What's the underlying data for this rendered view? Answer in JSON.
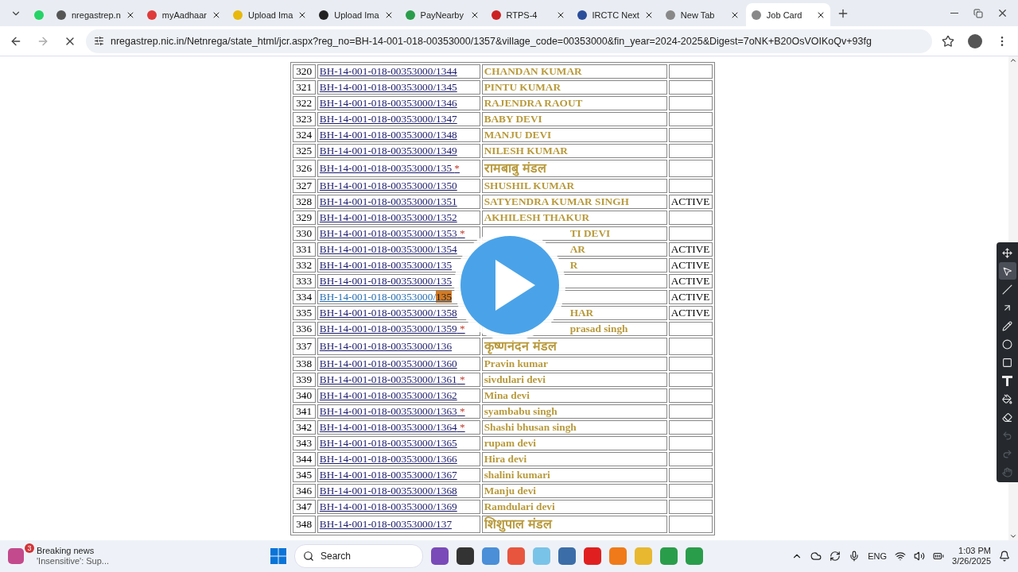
{
  "tabs": [
    {
      "kind": "pinned",
      "selected": false
    },
    {
      "title": "nregastrep.n",
      "selected": false
    },
    {
      "title": "myAadhaar",
      "selected": false
    },
    {
      "title": "Upload Ima",
      "selected": false
    },
    {
      "title": "Upload Ima",
      "selected": false
    },
    {
      "title": "PayNearby",
      "selected": false
    },
    {
      "title": "RTPS-4",
      "selected": false
    },
    {
      "title": "IRCTC Next",
      "selected": false
    },
    {
      "title": "New Tab",
      "selected": false
    },
    {
      "title": "Job Card",
      "selected": true
    }
  ],
  "address": "nregastrep.nic.in/Netnrega/state_html/jcr.aspx?reg_no=BH-14-001-018-00353000/1357&village_code=00353000&fin_year=2024-2025&Digest=7oNK+B20OsVOIKoQv+93fg",
  "rows": [
    {
      "no": "320",
      "reg": "BH-14-001-018-00353000/1344",
      "name": "CHANDAN KUMAR"
    },
    {
      "no": "321",
      "reg": "BH-14-001-018-00353000/1345",
      "name": "PINTU KUMAR"
    },
    {
      "no": "322",
      "reg": "BH-14-001-018-00353000/1346",
      "name": "RAJENDRA RAOUT"
    },
    {
      "no": "323",
      "reg": "BH-14-001-018-00353000/1347",
      "name": "BABY DEVI"
    },
    {
      "no": "324",
      "reg": "BH-14-001-018-00353000/1348",
      "name": "MANJU DEVI"
    },
    {
      "no": "325",
      "reg": "BH-14-001-018-00353000/1349",
      "name": "NILESH KUMAR"
    },
    {
      "no": "326",
      "reg": "BH-14-001-018-00353000/135",
      "star": "*",
      "name": "रामबाबु मंडल",
      "kind": "devanagari"
    },
    {
      "no": "327",
      "reg": "BH-14-001-018-00353000/1350",
      "name": "SHUSHIL KUMAR"
    },
    {
      "no": "328",
      "reg": "BH-14-001-018-00353000/1351",
      "name": "SATYENDRA KUMAR SINGH",
      "status": "ACTIVE"
    },
    {
      "no": "329",
      "reg": "BH-14-001-018-00353000/1352",
      "name": "AKHILESH THAKUR"
    },
    {
      "no": "330",
      "reg": "BH-14-001-018-00353000/1353",
      "star": "*",
      "name": "TI DEVI",
      "covered": true
    },
    {
      "no": "331",
      "reg": "BH-14-001-018-00353000/1354",
      "name": "AR",
      "covered": true,
      "status": "ACTIVE"
    },
    {
      "no": "332",
      "reg": "BH-14-001-018-00353000/135",
      "name": "R",
      "covered": true,
      "status": "ACTIVE"
    },
    {
      "no": "333",
      "reg": "BH-14-001-018-00353000/135",
      "status": "ACTIVE"
    },
    {
      "no": "334",
      "reg": "BH-14-001-018-00353000/",
      "highlight": "135",
      "hover": true,
      "status": "ACTIVE"
    },
    {
      "no": "335",
      "reg": "BH-14-001-018-00353000/1358",
      "name": "HAR",
      "covered": true,
      "status": "ACTIVE"
    },
    {
      "no": "336",
      "reg": "BH-14-001-018-00353000/1359",
      "star": "*",
      "name": "prasad singh",
      "covered": true
    },
    {
      "no": "337",
      "reg": "BH-14-001-018-00353000/136",
      "name": "कृष्णनंदन मंडल",
      "kind": "devanagari"
    },
    {
      "no": "338",
      "reg": "BH-14-001-018-00353000/1360",
      "name": "Pravin kumar"
    },
    {
      "no": "339",
      "reg": "BH-14-001-018-00353000/1361",
      "star": "*",
      "name": "sivdulari devi"
    },
    {
      "no": "340",
      "reg": "BH-14-001-018-00353000/1362",
      "name": "Mina devi"
    },
    {
      "no": "341",
      "reg": "BH-14-001-018-00353000/1363",
      "star": "*",
      "name": "syambabu singh"
    },
    {
      "no": "342",
      "reg": "BH-14-001-018-00353000/1364",
      "star": "*",
      "name": "Shashi bhusan singh"
    },
    {
      "no": "343",
      "reg": "BH-14-001-018-00353000/1365",
      "name": "rupam devi"
    },
    {
      "no": "344",
      "reg": "BH-14-001-018-00353000/1366",
      "name": "Hira devi"
    },
    {
      "no": "345",
      "reg": "BH-14-001-018-00353000/1367",
      "name": "shalini kumari"
    },
    {
      "no": "346",
      "reg": "BH-14-001-018-00353000/1368",
      "name": "Manju devi"
    },
    {
      "no": "347",
      "reg": "BH-14-001-018-00353000/1369",
      "name": "Ramdulari devi"
    },
    {
      "no": "348",
      "reg": "BH-14-001-018-00353000/137",
      "name": "शिशुपाल मंडल",
      "kind": "devanagari"
    }
  ],
  "annotation_tools": [
    {
      "kind": "move",
      "selected": false
    },
    {
      "kind": "pointer",
      "selected": true
    },
    {
      "kind": "line",
      "selected": false
    },
    {
      "kind": "arrow",
      "selected": false
    },
    {
      "kind": "pencil",
      "selected": false
    },
    {
      "kind": "circle",
      "selected": false
    },
    {
      "kind": "rect",
      "selected": false
    },
    {
      "kind": "text",
      "selected": false
    },
    {
      "kind": "fill",
      "selected": false
    },
    {
      "kind": "eraser",
      "selected": false
    },
    {
      "kind": "undo",
      "selected": false,
      "disabled": true
    },
    {
      "kind": "redo",
      "selected": false,
      "disabled": true
    },
    {
      "kind": "hand",
      "selected": false,
      "disabled": true
    }
  ],
  "taskbar": {
    "news": {
      "badge": "3",
      "title": "Breaking news",
      "subtitle": "'Insensitive': Sup..."
    },
    "search": "Search",
    "language": "ENG",
    "time": "1:03 PM",
    "date": "3/26/2025"
  }
}
